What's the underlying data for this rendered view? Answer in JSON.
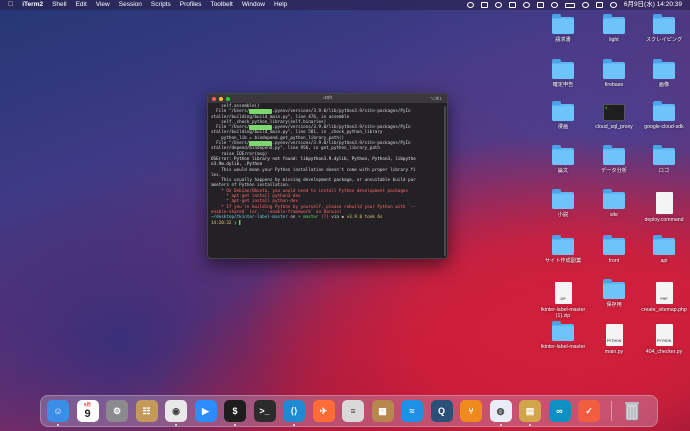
{
  "menubar": {
    "apple": "",
    "app": "iTerm2",
    "items": [
      "Shell",
      "Edit",
      "View",
      "Session",
      "Scripts",
      "Profiles",
      "Toolbelt",
      "Window",
      "Help"
    ],
    "clock": "6月9日(水)  14:20:39"
  },
  "terminal": {
    "title": "-zsh",
    "shortcut": "⌥⌘1",
    "lines": [
      "    self.assemble()",
      "  File \"/Users/",
      "staller/building/build_main.py\", line 476, in assemble",
      "    self._check_python_library(self.binaries)",
      "  File \"/Users/",
      "staller/building/build_main.py\", line 581, in _check_python_library",
      "    python_lib = bindepend.get_python_library_path()",
      "  File \"/Users/",
      "staller/depend/bindepend.py\", line 956, in get_python_library_path",
      "    raise IOError(msg)",
      "OSError: Python library not found: libpython3.9.dylib, Python, Python3, libpytho",
      "n3.9m.dylib, .Python",
      "    This would mean your Python installation doesn't come with proper library fi",
      "les.",
      "    This usually happens by missing development package, or unsuitable build par",
      "ameters of Python installation.",
      "",
      "    * On Debian/Ubuntu, you would need to install Python development packages",
      "      * apt-get install python3-dev",
      "      * apt-get install python-dev",
      "    * If you're building Python by yourself, please rebuild your Python with `--",
      "enable-shared` (or, `--enable-framework` on Darwin)",
      ""
    ],
    "file_tail": ".pyenv/versions/3.9.0/lib/python3.9/site-packages/PyIn",
    "prompt_path": "~/desktop/tkinter-label-master",
    "prompt_on": " on ",
    "prompt_branch": " master",
    "prompt_status": " [?]",
    "prompt_via": " via ",
    "prompt_python": " v3.9.0",
    "prompt_took": " took 6s",
    "prompt_time": "14:20:32"
  },
  "desktop_icons": [
    {
      "label": "請求書",
      "kind": "folder"
    },
    {
      "label": "light",
      "kind": "folder"
    },
    {
      "label": "スクレイピング",
      "kind": "folder"
    },
    {
      "label": "確定申告",
      "kind": "folder"
    },
    {
      "label": "firebase",
      "kind": "folder"
    },
    {
      "label": "画像",
      "kind": "folder"
    },
    {
      "label": "漫画",
      "kind": "folder"
    },
    {
      "label": "cloud_sql_proxy",
      "kind": "terminal"
    },
    {
      "label": "google-cloud-sdk",
      "kind": "folder"
    },
    {
      "label": "論文",
      "kind": "folder"
    },
    {
      "label": "データ分析",
      "kind": "folder"
    },
    {
      "label": "ロゴ",
      "kind": "folder"
    },
    {
      "label": "小説",
      "kind": "folder"
    },
    {
      "label": "site",
      "kind": "folder"
    },
    {
      "label": "deploy.command",
      "kind": "doc",
      "tag": ""
    },
    {
      "label": "サイト作成副業",
      "kind": "folder"
    },
    {
      "label": "front",
      "kind": "folder"
    },
    {
      "label": "api",
      "kind": "folder"
    },
    {
      "label": "tkinter-label-master (1).zip",
      "kind": "doc",
      "tag": "ZIP"
    },
    {
      "label": "保存用",
      "kind": "folder"
    },
    {
      "label": "create_sitemap.php",
      "kind": "doc",
      "tag": "PHP"
    },
    {
      "label": "tkinter-label-master",
      "kind": "folder"
    },
    {
      "label": "main.py",
      "kind": "doc",
      "tag": "PYTHON"
    },
    {
      "label": "404_checker.py",
      "kind": "doc",
      "tag": "PYTHON"
    }
  ],
  "dock": {
    "apps": [
      {
        "name": "finder",
        "glyph": "☺",
        "color": "#3a8ee8"
      },
      {
        "name": "calendar",
        "glyph": "9",
        "color": "#ffffff"
      },
      {
        "name": "system-preferences",
        "glyph": "⚙",
        "color": "#8a8a8f"
      },
      {
        "name": "contacts",
        "glyph": "☷",
        "color": "#c49a5c"
      },
      {
        "name": "chrome",
        "glyph": "◉",
        "color": "#e9e9e9"
      },
      {
        "name": "zoom",
        "glyph": "▶",
        "color": "#2d8cff"
      },
      {
        "name": "iterm",
        "glyph": "$",
        "color": "#1d1d1d"
      },
      {
        "name": "terminal",
        "glyph": ">_",
        "color": "#2b2b2b"
      },
      {
        "name": "vscode",
        "glyph": "⟨⟩",
        "color": "#1f8ad2"
      },
      {
        "name": "postman",
        "glyph": "✈",
        "color": "#ff6c37"
      },
      {
        "name": "sequel-pro",
        "glyph": "≡",
        "color": "#d9d9d9"
      },
      {
        "name": "archive-utility",
        "glyph": "▦",
        "color": "#b8874d"
      },
      {
        "name": "docker",
        "glyph": "≈",
        "color": "#1d91e6"
      },
      {
        "name": "quicktime",
        "glyph": "Q",
        "color": "#2c4f77"
      },
      {
        "name": "sourcetree",
        "glyph": "⑂",
        "color": "#ef8a1f"
      },
      {
        "name": "gitkraken",
        "glyph": "◍",
        "color": "#e8eef8"
      },
      {
        "name": "preview",
        "glyph": "▤",
        "color": "#d3a54a"
      },
      {
        "name": "arduino",
        "glyph": "∞",
        "color": "#0f90c4"
      },
      {
        "name": "reminders",
        "glyph": "✓",
        "color": "#f25c3f"
      }
    ],
    "calendar_month": "6月",
    "calendar_day": "9",
    "trash": "trash-icon"
  }
}
